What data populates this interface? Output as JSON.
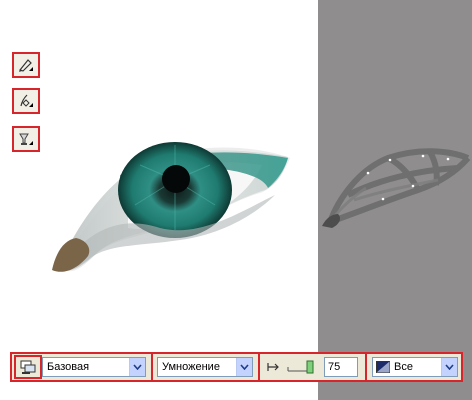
{
  "toolbar": {
    "layer_select_value": "Базовая",
    "blend_select_value": "Умножение",
    "opacity_value": "75",
    "channels_select_value": "Все"
  },
  "icons": {
    "tool_1": "pen-icon",
    "tool_2": "node-edit-icon",
    "tool_3": "transparency-icon",
    "toolbar_left": "layers-icon",
    "opacity": "opacity-slider-icon",
    "channels": "channel-swatch-icon"
  },
  "colors": {
    "accent_border": "#d6262c",
    "toolbar_bg": "#ece9d8",
    "right_panel_bg": "#8f8d8e",
    "iris": "#2a8f83"
  }
}
